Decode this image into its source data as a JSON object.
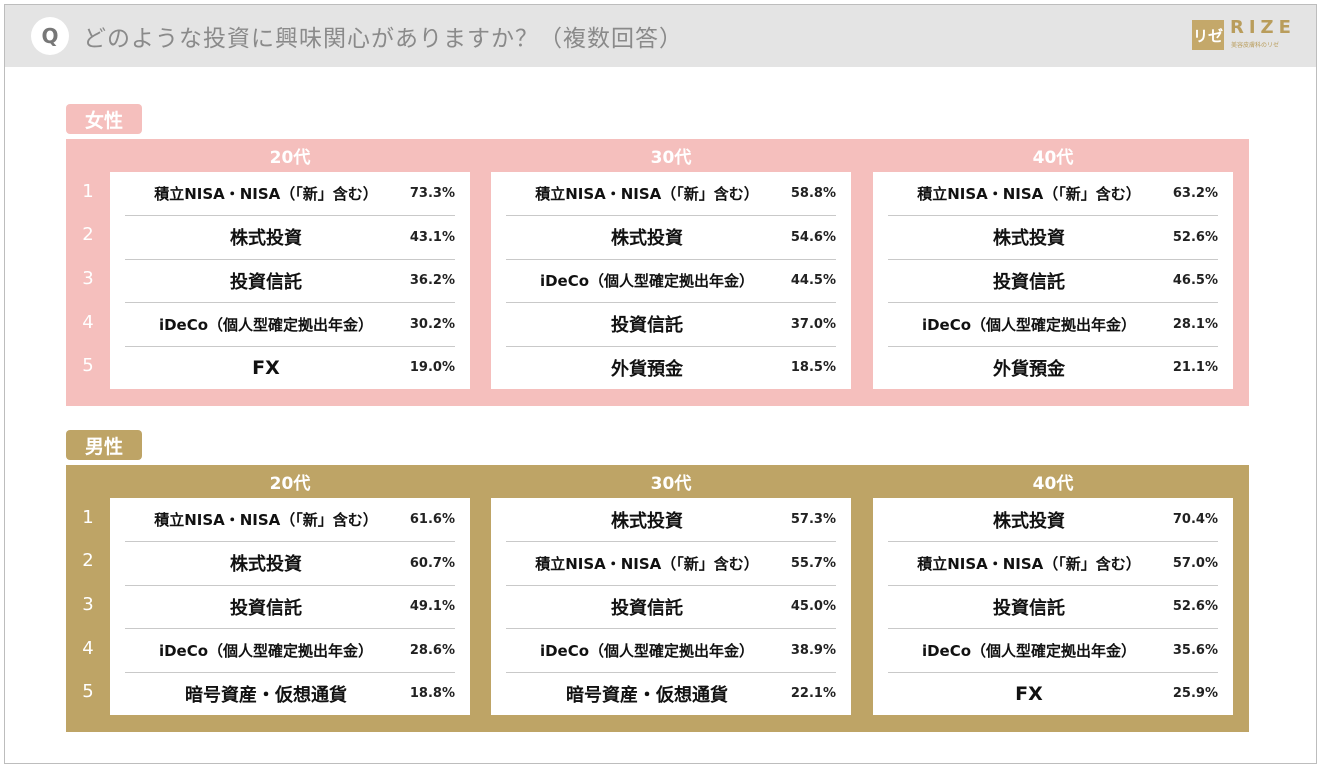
{
  "header": {
    "q_badge": "Q",
    "title": "どのような投資に興味関心がありますか？（複数回答）",
    "logo_mark": "リゼ",
    "logo_text": "RIZE",
    "logo_sub": "美容皮膚科のリゼ"
  },
  "colors": {
    "female": "#f5bfbd",
    "male": "#bea466"
  },
  "ranks": [
    "1",
    "2",
    "3",
    "4",
    "5"
  ],
  "groups": [
    {
      "label": "女性",
      "columns": [
        {
          "age": "20代",
          "rows": [
            {
              "item": "積立NISA・NISA（「新」含む）",
              "pct": "73.3%"
            },
            {
              "item": "株式投資",
              "pct": "43.1%"
            },
            {
              "item": "投資信託",
              "pct": "36.2%"
            },
            {
              "item": "iDeCo（個人型確定拠出年金）",
              "pct": "30.2%"
            },
            {
              "item": "FX",
              "pct": "19.0%"
            }
          ]
        },
        {
          "age": "30代",
          "rows": [
            {
              "item": "積立NISA・NISA（「新」含む）",
              "pct": "58.8%"
            },
            {
              "item": "株式投資",
              "pct": "54.6%"
            },
            {
              "item": "iDeCo（個人型確定拠出年金）",
              "pct": "44.5%"
            },
            {
              "item": "投資信託",
              "pct": "37.0%"
            },
            {
              "item": "外貨預金",
              "pct": "18.5%"
            }
          ]
        },
        {
          "age": "40代",
          "rows": [
            {
              "item": "積立NISA・NISA（「新」含む）",
              "pct": "63.2%"
            },
            {
              "item": "株式投資",
              "pct": "52.6%"
            },
            {
              "item": "投資信託",
              "pct": "46.5%"
            },
            {
              "item": "iDeCo（個人型確定拠出年金）",
              "pct": "28.1%"
            },
            {
              "item": "外貨預金",
              "pct": "21.1%"
            }
          ]
        }
      ]
    },
    {
      "label": "男性",
      "columns": [
        {
          "age": "20代",
          "rows": [
            {
              "item": "積立NISA・NISA（「新」含む）",
              "pct": "61.6%"
            },
            {
              "item": "株式投資",
              "pct": "60.7%"
            },
            {
              "item": "投資信託",
              "pct": "49.1%"
            },
            {
              "item": "iDeCo（個人型確定拠出年金）",
              "pct": "28.6%"
            },
            {
              "item": "暗号資産・仮想通貨",
              "pct": "18.8%"
            }
          ]
        },
        {
          "age": "30代",
          "rows": [
            {
              "item": "株式投資",
              "pct": "57.3%"
            },
            {
              "item": "積立NISA・NISA（「新」含む）",
              "pct": "55.7%"
            },
            {
              "item": "投資信託",
              "pct": "45.0%"
            },
            {
              "item": "iDeCo（個人型確定拠出年金）",
              "pct": "38.9%"
            },
            {
              "item": "暗号資産・仮想通貨",
              "pct": "22.1%"
            }
          ]
        },
        {
          "age": "40代",
          "rows": [
            {
              "item": "株式投資",
              "pct": "70.4%"
            },
            {
              "item": "積立NISA・NISA（「新」含む）",
              "pct": "57.0%"
            },
            {
              "item": "投資信託",
              "pct": "52.6%"
            },
            {
              "item": "iDeCo（個人型確定拠出年金）",
              "pct": "35.6%"
            },
            {
              "item": "FX",
              "pct": "25.9%"
            }
          ]
        }
      ]
    }
  ]
}
